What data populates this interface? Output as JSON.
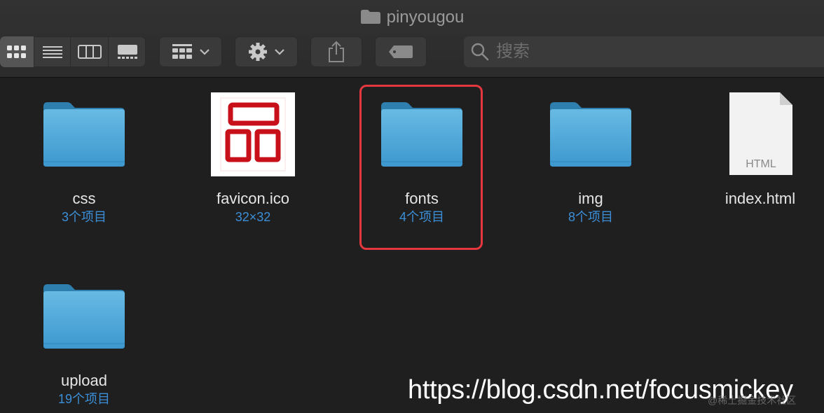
{
  "window": {
    "title": "pinyougou"
  },
  "toolbar": {
    "view_icons": [
      "grid-view-icon",
      "list-view-icon",
      "column-view-icon",
      "gallery-view-icon"
    ],
    "group_icon": "group-by-icon",
    "action_icon": "gear-icon",
    "share_icon": "share-icon",
    "tag_icon": "tag-icon"
  },
  "search": {
    "placeholder": "搜索"
  },
  "items": [
    {
      "name": "css",
      "sub": "3个项目",
      "type": "folder"
    },
    {
      "name": "favicon.ico",
      "sub": "32×32",
      "type": "ico"
    },
    {
      "name": "fonts",
      "sub": "4个项目",
      "type": "folder",
      "selected": true
    },
    {
      "name": "img",
      "sub": "8个项目",
      "type": "folder"
    },
    {
      "name": "index.html",
      "sub": "",
      "type": "html",
      "badge": "HTML"
    },
    {
      "name": "upload",
      "sub": "19个项目",
      "type": "folder"
    }
  ],
  "watermark": {
    "text": "https://blog.csdn.net/focusmickey",
    "sub": "@稀土掘金技术社区"
  },
  "colors": {
    "folder_top": "#63b6e0",
    "folder_bottom": "#3e9ad0",
    "subtext": "#3b8fd9",
    "selection": "#e5373e",
    "ico_red": "#c8101a"
  }
}
